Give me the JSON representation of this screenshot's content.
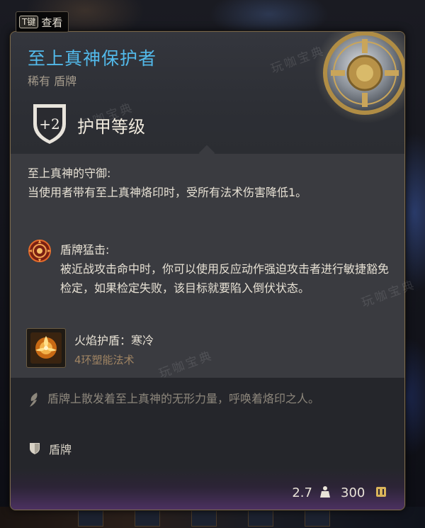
{
  "hint": {
    "key": "T键",
    "label": "查看"
  },
  "item": {
    "name": "至上真神保护者",
    "rarity_type": "稀有 盾牌",
    "armor_bonus": "+2",
    "armor_label": "护甲等级"
  },
  "passive": {
    "name": "至上真神的守御:",
    "description": "当使用者带有至上真神烙印时，受所有法术伤害降低1。"
  },
  "shield_bash": {
    "name": "盾牌猛击:",
    "description": "被近战攻击命中时，你可以使用反应动作强迫攻击者进行敏捷豁免检定，如果检定失败，该目标就要陷入倒伏状态。"
  },
  "spell": {
    "name": "火焰护盾：寒冷",
    "subtitle": "4环塑能法术"
  },
  "flavor": "盾牌上散发着至上真神的无形力量，呼唤着烙印之人。",
  "item_type": "盾牌",
  "footer": {
    "weight": "2.7",
    "price": "300"
  },
  "watermark": "玩咖宝典",
  "colors": {
    "title": "#52b9ea",
    "rarity": "#a59b8c",
    "spell_sub": "#a08463",
    "footer_glow": "#4b3160"
  },
  "icons": [
    "shield-badge-icon",
    "shield-bash-icon",
    "fire-shield-spell-icon",
    "feather-icon",
    "shield-type-icon",
    "weight-icon",
    "coin-icon"
  ]
}
